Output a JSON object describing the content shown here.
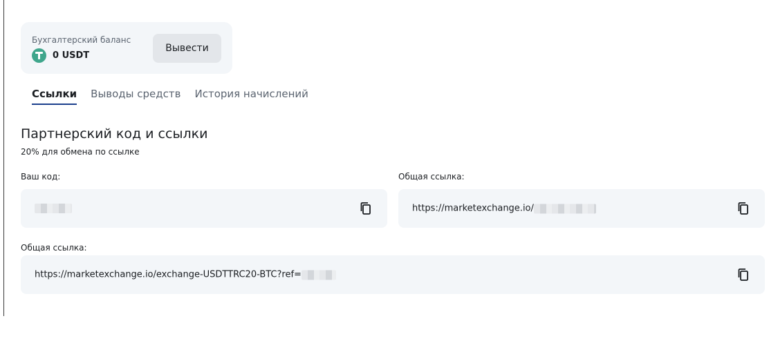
{
  "balance": {
    "label": "Бухгалтерский баланс",
    "value": "0 USDT",
    "withdraw_label": "Вывести",
    "currency_icon": "tether-icon"
  },
  "tabs": [
    {
      "label": "Ссылки",
      "active": true
    },
    {
      "label": "Выводы средств",
      "active": false
    },
    {
      "label": "История начислений",
      "active": false
    }
  ],
  "section": {
    "title": "Партнерский код и ссылки",
    "subtitle": "20% для обмена по ссылке"
  },
  "fields": {
    "code": {
      "label": "Ваш код:",
      "value": ""
    },
    "general_link": {
      "label": "Общая ссылка:",
      "value": "https://marketexchange.io/"
    },
    "exchange_link": {
      "label": "Общая ссылка:",
      "value": "https://marketexchange.io/exchange-USDTTRC20-BTC?ref="
    }
  },
  "colors": {
    "accent": "#1b3f8c",
    "field_bg": "#f3f6f9",
    "tether": "#3fa68c"
  }
}
